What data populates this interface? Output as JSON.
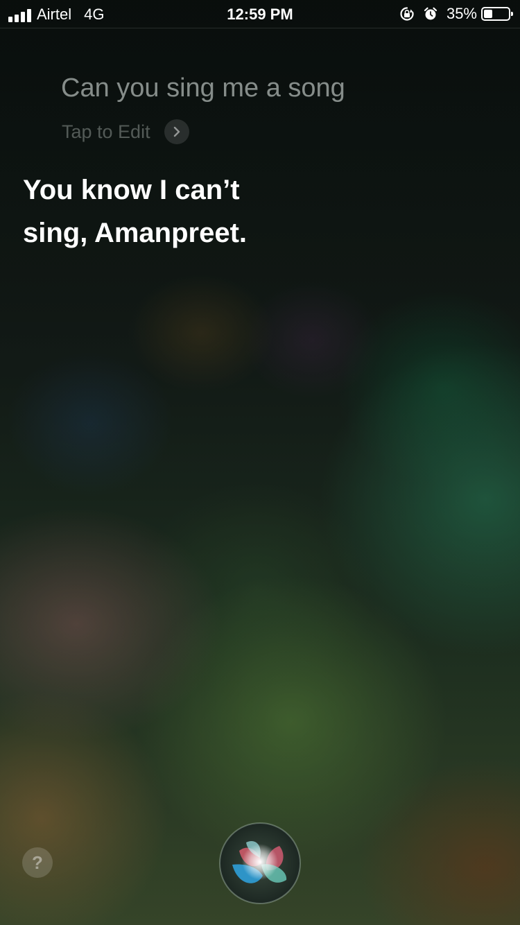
{
  "status_bar": {
    "carrier": "Airtel",
    "network": "4G",
    "time": "12:59 PM",
    "battery_percent_label": "35%",
    "battery_level": 0.35,
    "icons": [
      "signal-bars-icon",
      "orientation-lock-icon",
      "alarm-icon",
      "battery-icon"
    ]
  },
  "siri": {
    "query": "Can you sing me a song",
    "tap_to_edit": "Tap to Edit",
    "response_line1": "You know I can’t",
    "response_line2": "sing, Amanpreet.",
    "help_label": "?"
  },
  "colors": {
    "query_text": "#d2dad6",
    "response_text": "#ffffff"
  }
}
